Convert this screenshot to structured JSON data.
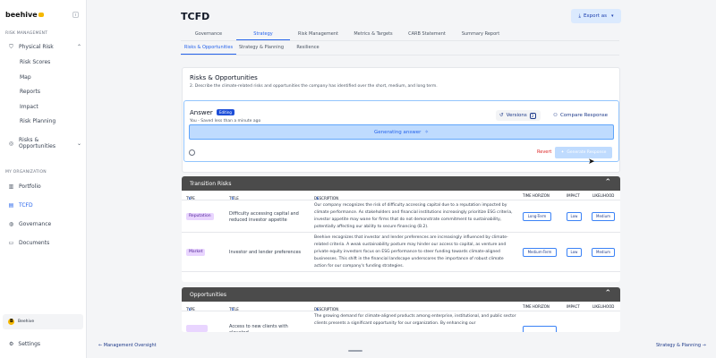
{
  "app": {
    "logo_text": "beehive"
  },
  "sidebar": {
    "risk_section": "RISK MANAGEMENT",
    "physical_risk": "Physical Risk",
    "subitems": [
      "Risk Scores",
      "Map",
      "Reports",
      "Impact",
      "Risk Planning"
    ],
    "risks_opps_line1": "Risks &",
    "risks_opps_line2": "Opportunities",
    "org_section": "MY ORGANIZATION",
    "org_items": [
      "Portfolio",
      "TCFD",
      "Governance",
      "Documents"
    ],
    "org_name": "Beehive",
    "settings": "Settings"
  },
  "header": {
    "title": "TCFD",
    "export_label": "Export as"
  },
  "tabs": [
    "Governance",
    "Strategy",
    "Risk Management",
    "Metrics & Targets",
    "CARB Statement",
    "Summary Report"
  ],
  "subtabs": [
    "Risks & Opportunities",
    "Strategy & Planning",
    "Resilience"
  ],
  "question": {
    "heading": "Risks & Opportunities",
    "text": "2. Describe the climate-related risks and opportunities the company has identified over the short, medium, and long term."
  },
  "answer": {
    "label": "Answer",
    "badge": "Editing",
    "saved": "You - Saved less than a minute ago",
    "versions": "Versions",
    "versions_count": "2",
    "compare": "Compare Response",
    "generating": "Generating answer",
    "revert": "Revert",
    "regenerate": "Generate Response"
  },
  "columns": {
    "type": "TYPE",
    "title": "TITLE",
    "description": "DESCRIPTION",
    "horizon": "TIME HORIZON",
    "impact": "IMPACT",
    "likelihood": "LIKELIHOOD"
  },
  "transition": {
    "heading": "Transition Risks",
    "rows": [
      {
        "type": "Reputation",
        "title": "Difficulty accessing capital and reduced investor appetite",
        "desc": "Our company recognizes the risk of difficulty accessing capital due to a reputation impacted by climate performance. As stakeholders and financial institutions increasingly prioritize ESG criteria, investor appetite may wane for firms that do not demonstrate commitment to sustainability, potentially affecting our ability to secure financing (B.2).",
        "horizon": "Long-Term",
        "impact": "Low",
        "likelihood": "Medium"
      },
      {
        "type": "Market",
        "title": "Investor and lender preferences",
        "desc": "Beehive recognizes that investor and lender preferences are increasingly influenced by climate-related criteria. A weak sustainability posture may hinder our access to capital, as venture and private equity investors focus on ESG performance to steer funding towards climate-aligned businesses. This shift in the financial landscape underscores the importance of robust climate action for our company's funding strategies.",
        "horizon": "Medium-Term",
        "impact": "Low",
        "likelihood": "Medium"
      }
    ]
  },
  "opportunities": {
    "heading": "Opportunities",
    "rows": [
      {
        "title": "Access to new clients with elevated",
        "desc": "The growing demand for climate-aligned products among enterprise, institutional, and public sector clients presents a significant opportunity for our organization. By enhancing our"
      }
    ]
  },
  "footer": {
    "prev": "Management Oversight",
    "next": "Strategy & Planning"
  }
}
